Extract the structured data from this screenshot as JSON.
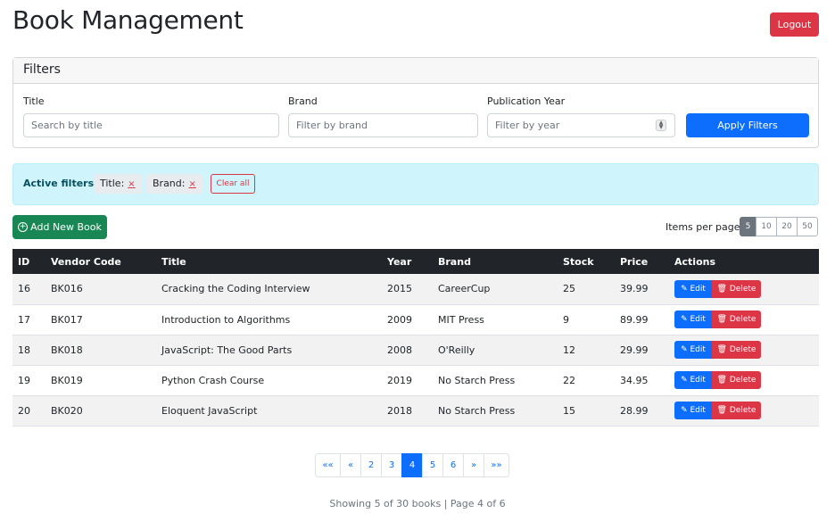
{
  "header": {
    "title": "Book Management",
    "logout_label": "Logout"
  },
  "filters": {
    "heading": "Filters",
    "title_label": "Title",
    "title_placeholder": "Search by title",
    "brand_label": "Brand",
    "brand_placeholder": "Filter by brand",
    "year_label": "Publication Year",
    "year_placeholder": "Filter by year",
    "apply_label": "Apply Filters"
  },
  "active_filters": {
    "label": "Active filters:",
    "chips": [
      {
        "label": "Title:",
        "remove": "×"
      },
      {
        "label": "Brand:",
        "remove": "×"
      }
    ],
    "clear_label": "Clear all"
  },
  "toolbar": {
    "add_label": "Add New Book",
    "items_per_page_label": "Items per page:",
    "page_sizes": [
      "5",
      "10",
      "20",
      "50"
    ],
    "selected_page_size": "5"
  },
  "table": {
    "columns": [
      "ID",
      "Vendor Code",
      "Title",
      "Year",
      "Brand",
      "Stock",
      "Price",
      "Actions"
    ],
    "edit_label": "Edit",
    "delete_label": "Delete",
    "rows": [
      {
        "id": "16",
        "vendor": "BK016",
        "title": "Cracking the Coding Interview",
        "year": "2015",
        "brand": "CareerCup",
        "stock": "25",
        "price": "39.99"
      },
      {
        "id": "17",
        "vendor": "BK017",
        "title": "Introduction to Algorithms",
        "year": "2009",
        "brand": "MIT Press",
        "stock": "9",
        "price": "89.99"
      },
      {
        "id": "18",
        "vendor": "BK018",
        "title": "JavaScript: The Good Parts",
        "year": "2008",
        "brand": "O'Reilly",
        "stock": "12",
        "price": "29.99"
      },
      {
        "id": "19",
        "vendor": "BK019",
        "title": "Python Crash Course",
        "year": "2019",
        "brand": "No Starch Press",
        "stock": "22",
        "price": "34.95"
      },
      {
        "id": "20",
        "vendor": "BK020",
        "title": "Eloquent JavaScript",
        "year": "2018",
        "brand": "No Starch Press",
        "stock": "15",
        "price": "28.99"
      }
    ]
  },
  "pagination": {
    "first": "««",
    "prev": "«",
    "next": "»",
    "last": "»»",
    "pages": [
      "2",
      "3",
      "4",
      "5",
      "6"
    ],
    "current": "4"
  },
  "summary": "Showing 5 of 30 books | Page 4 of 6",
  "colors": {
    "primary": "#0d6efd",
    "danger": "#dc3545",
    "success": "#198754",
    "dark": "#212529",
    "info_bg": "#cff4fc"
  }
}
